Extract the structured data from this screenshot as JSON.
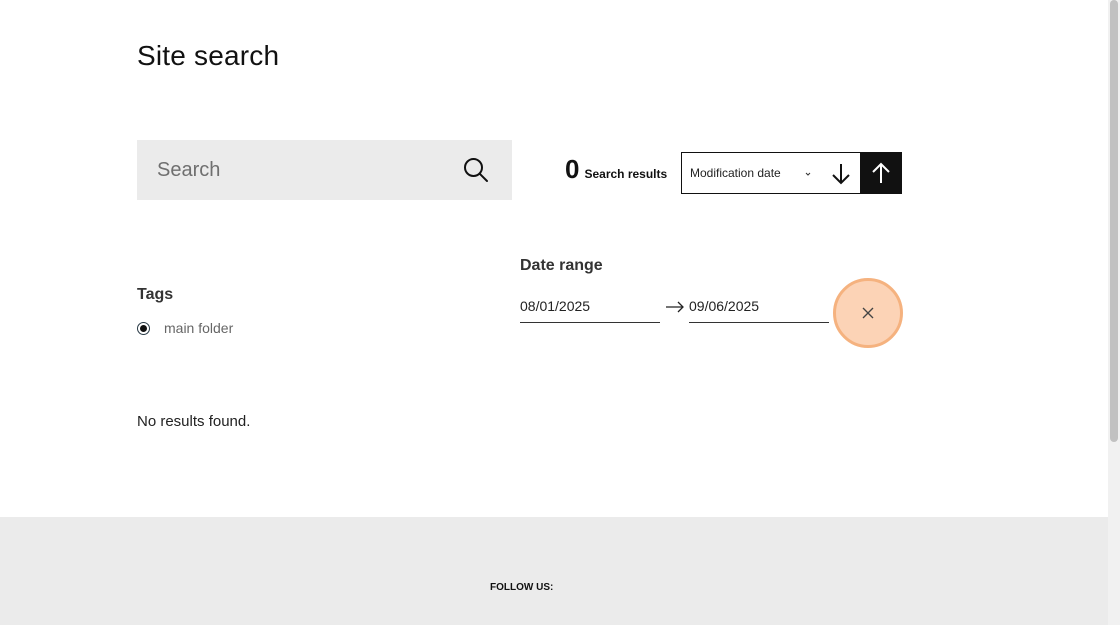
{
  "page": {
    "title": "Site search"
  },
  "search": {
    "placeholder": "Search",
    "value": ""
  },
  "results": {
    "count": "0",
    "label": "Search results",
    "empty_message": "No results found."
  },
  "sort": {
    "selected": "Modification date",
    "options": [
      "Modification date"
    ]
  },
  "tags": {
    "heading": "Tags",
    "items": [
      {
        "label": "main folder",
        "selected": true
      }
    ]
  },
  "date_range": {
    "heading": "Date range",
    "from": "08/01/2025",
    "to": "09/06/2025"
  },
  "footer": {
    "follow_label": "FOLLOW US:"
  },
  "icons": {
    "search": "search-icon",
    "chevron": "chevron-down-icon",
    "sort_desc": "arrow-down-icon",
    "sort_asc": "arrow-up-icon",
    "range_arrow": "arrow-right-icon",
    "clear": "close-icon"
  },
  "colors": {
    "search_bg": "#ebebeb",
    "sort_active_bg": "#111111",
    "clear_bg": "#fcd3b6",
    "clear_border": "#f5b27f",
    "footer_bg": "#ebebeb"
  }
}
